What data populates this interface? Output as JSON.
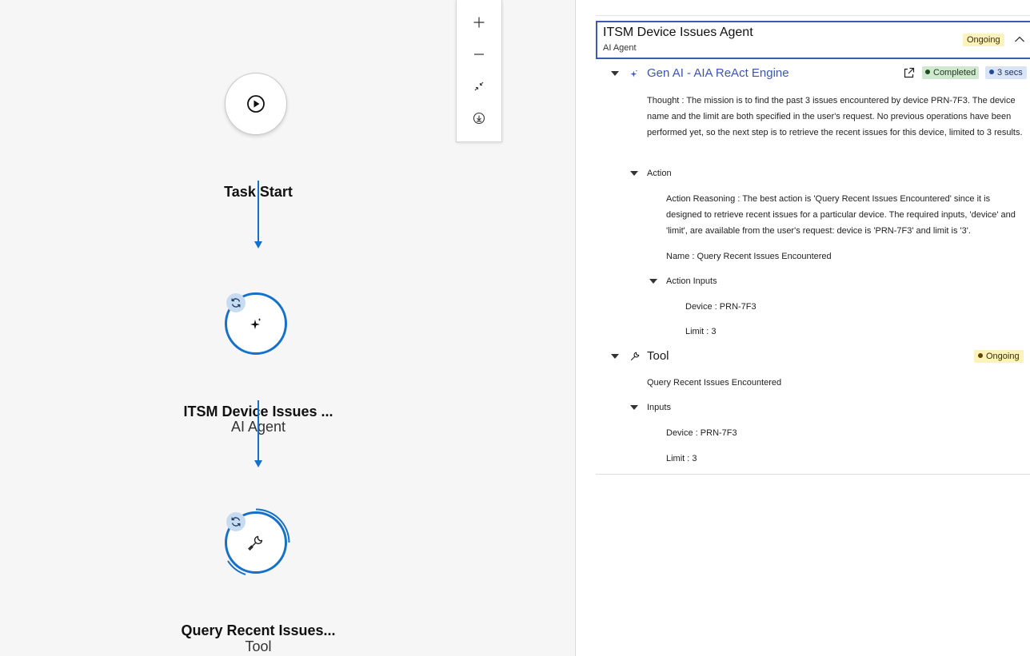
{
  "canvas": {
    "nodes": [
      {
        "title": "Task Start",
        "subtitle": ""
      },
      {
        "title": "ITSM Device Issues ...",
        "subtitle": "AI Agent"
      },
      {
        "title": "Query Recent Issues...",
        "subtitle": "Tool"
      }
    ],
    "zoom_controls": [
      "zoom-in-icon",
      "zoom-out-icon",
      "fit-view-icon",
      "download-icon"
    ],
    "colors": {
      "accent": "#1570c9",
      "badge": "#c8dcf1",
      "background": "#f6f6f6"
    }
  },
  "panel": {
    "agent": {
      "title": "ITSM Device Issues Agent",
      "subtitle": "AI Agent",
      "status": "Ongoing"
    },
    "engine": {
      "title": "Gen AI - AIA ReAct Engine",
      "status": "Completed",
      "duration": "3 secs",
      "thought": "Thought : The mission is to find the past 3 issues encountered by device PRN-7F3. The device name and the limit are both specified in the user's request. No previous operations have been performed yet, so the next step is to retrieve the recent issues for this device, limited to 3 results.",
      "action": {
        "label": "Action",
        "reasoning": "Action Reasoning : The best action is 'Query Recent Issues Encountered' since it is designed to retrieve recent issues for a particular device. The required inputs, 'device' and 'limit', are available from the user's request: device is 'PRN-7F3' and limit is '3'.",
        "name": "Name : Query Recent Issues Encountered",
        "inputs_label": "Action Inputs",
        "inputs": [
          "Device : PRN-7F3",
          "Limit : 3"
        ]
      }
    },
    "tool": {
      "title": "Tool",
      "status": "Ongoing",
      "name": "Query Recent Issues Encountered",
      "inputs_label": "Inputs",
      "inputs": [
        "Device : PRN-7F3",
        "Limit : 3"
      ]
    },
    "colors": {
      "header_border": "#3d5bb3",
      "ongoing_bg": "#fbf2bc",
      "completed_bg": "#cfe8cf",
      "time_bg": "#d9e5f6"
    }
  }
}
